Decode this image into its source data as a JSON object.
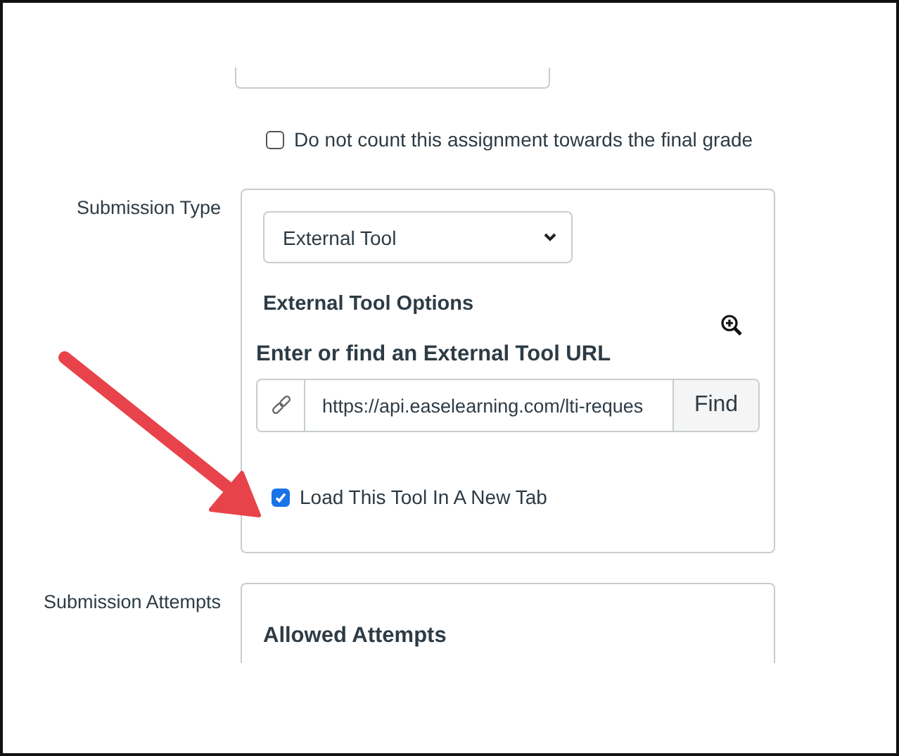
{
  "grade_option": {
    "label": "Do not count this assignment towards the final grade",
    "checked": false
  },
  "submission_type": {
    "label": "Submission Type",
    "select": {
      "value": "External Tool"
    },
    "options_heading": "External Tool Options",
    "url_heading": "Enter or find an External Tool URL",
    "url_field": {
      "value": "https://api.easelearning.com/lti-reques"
    },
    "find_button": "Find",
    "new_tab": {
      "label": "Load This Tool In A New Tab",
      "checked": true
    }
  },
  "submission_attempts": {
    "label": "Submission Attempts",
    "heading": "Allowed Attempts"
  }
}
